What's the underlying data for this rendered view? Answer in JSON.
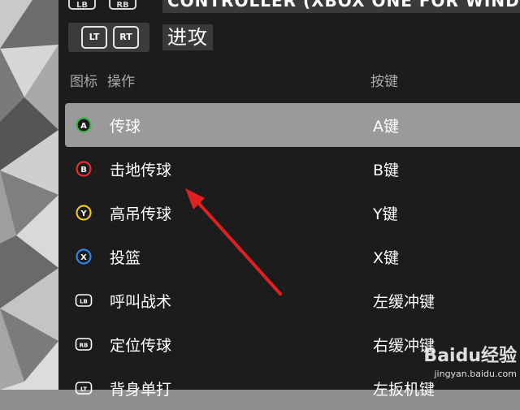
{
  "header_bar": {
    "left_pill_1": "LB",
    "left_pill_2": "RB",
    "title": "CONTROLLER (XBOX ONE FOR WIND"
  },
  "mode_bar": {
    "trigger_left": "LT",
    "trigger_right": "RT",
    "mode_title": "进攻"
  },
  "columns": {
    "icon": "图标",
    "action": "操作",
    "key": "按键"
  },
  "rows": [
    {
      "icon": "a-button-icon",
      "glyph": "A",
      "color": "#3fb54a",
      "action": "传球",
      "key": "A键",
      "selected": true
    },
    {
      "icon": "b-button-icon",
      "glyph": "B",
      "color": "#e1312b",
      "action": "击地传球",
      "key": "B键",
      "selected": false
    },
    {
      "icon": "y-button-icon",
      "glyph": "Y",
      "color": "#f2c21a",
      "action": "高吊传球",
      "key": "Y键",
      "selected": false
    },
    {
      "icon": "x-button-icon",
      "glyph": "X",
      "color": "#2f86e6",
      "action": "投篮",
      "key": "X键",
      "selected": false
    },
    {
      "icon": "lb-button-icon",
      "glyph": "LB",
      "color": "#ffffff",
      "action": "呼叫战术",
      "key": "左缓冲键",
      "selected": false
    },
    {
      "icon": "rb-button-icon",
      "glyph": "RB",
      "color": "#ffffff",
      "action": "定位传球",
      "key": "右缓冲键",
      "selected": false
    },
    {
      "icon": "lt-button-icon",
      "glyph": "LT",
      "color": "#ffffff",
      "action": "背身单打",
      "key": "左扳机键",
      "selected": false
    }
  ],
  "watermark": {
    "brand": "Baidu经验",
    "site": "jingyan.baidu.com"
  },
  "colors": {
    "panel": "#1c1c1c",
    "selected_row": "#9a9a9a",
    "arrow": "#e02020"
  }
}
